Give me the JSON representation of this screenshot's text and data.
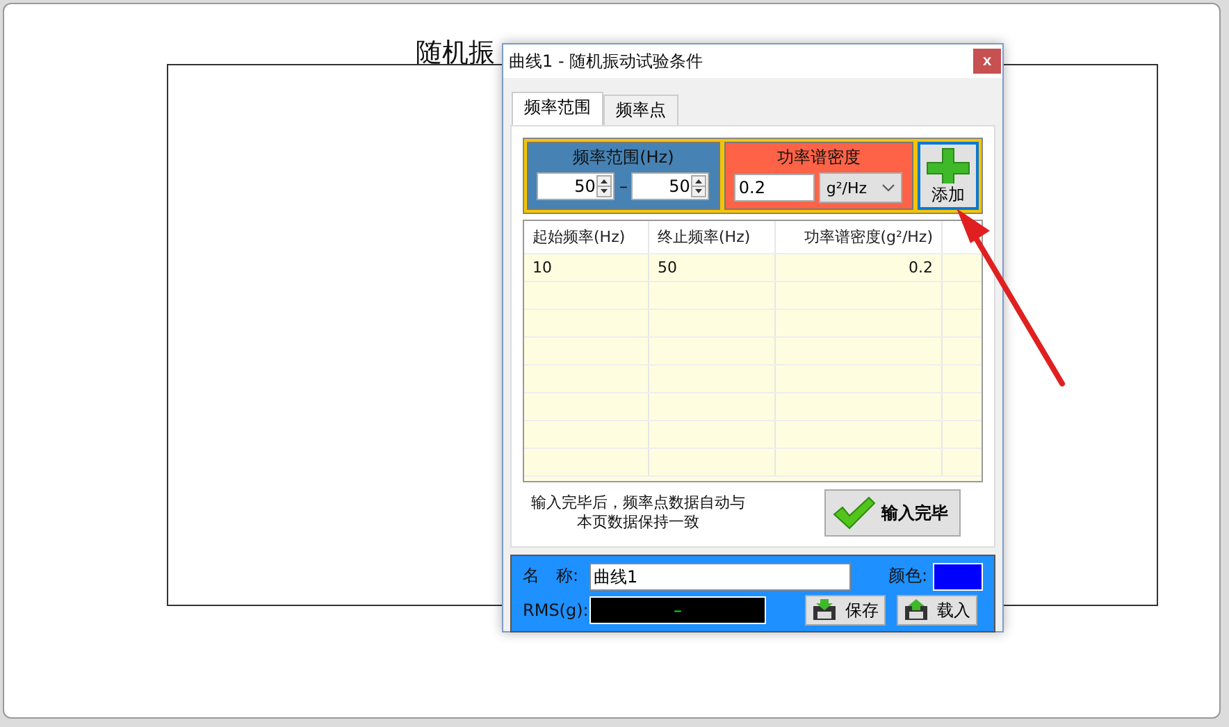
{
  "background_window": {
    "title": "随机振"
  },
  "dialog": {
    "title": "曲线1 - 随机振动试验条件",
    "close": "x",
    "tabs": [
      {
        "label": "频率范围",
        "selected": true
      },
      {
        "label": "频率点",
        "selected": false
      }
    ],
    "range": {
      "label": "频率范围(Hz)",
      "from": "50",
      "separator": "–",
      "to": "50"
    },
    "psd": {
      "label": "功率谱密度",
      "value": "0.2",
      "unit": "g²/Hz"
    },
    "add_button": "添加",
    "table": {
      "columns": [
        "起始频率(Hz)",
        "终止频率(Hz)",
        "功率谱密度(g²/Hz)"
      ],
      "rows": [
        [
          "10",
          "50",
          "0.2"
        ]
      ]
    },
    "note_lines": [
      "输入完毕后，频率点数据自动与",
      "本页数据保持一致"
    ],
    "done_button": "输入完毕",
    "name_label": "名　称:",
    "name_value": "曲线1",
    "color_label": "颜色:",
    "color": "#0000ff",
    "rms_label": "RMS(g):",
    "rms_value": "–",
    "save_button": "保存",
    "load_button": "载入"
  }
}
